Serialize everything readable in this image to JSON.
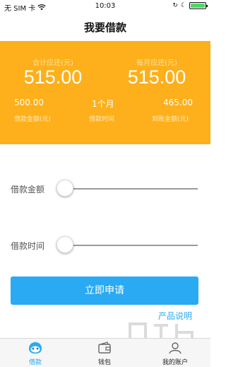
{
  "status_bar": {
    "carrier": "无 SIM 卡",
    "time": "10:03"
  },
  "nav": {
    "title": "我要借款"
  },
  "summary": {
    "total_repay_label": "合计应还(元)",
    "total_repay_value": "515.00",
    "monthly_repay_label": "每月应还(元)",
    "monthly_repay_value": "515.00",
    "loan_amount_value": "500.00",
    "loan_amount_label": "借款金额(元)",
    "loan_term_value": "1个月",
    "loan_term_label": "借款时间",
    "received_value": "465.00",
    "received_label": "到账金额(元)"
  },
  "sliders": {
    "amount_label": "借款金额",
    "amount_level": 0,
    "term_label": "借款时间",
    "term_level": 0
  },
  "apply_label": "立即申请",
  "product_info_label": "产品说明",
  "tabs": [
    {
      "label": "借款",
      "icon": "bird-face-icon",
      "active": true
    },
    {
      "label": "钱包",
      "icon": "wallet-icon",
      "active": false
    },
    {
      "label": "我的账户",
      "icon": "person-icon",
      "active": false
    }
  ],
  "colors": {
    "card_orange": "#fdb01b",
    "accent_blue": "#29aaf3"
  }
}
